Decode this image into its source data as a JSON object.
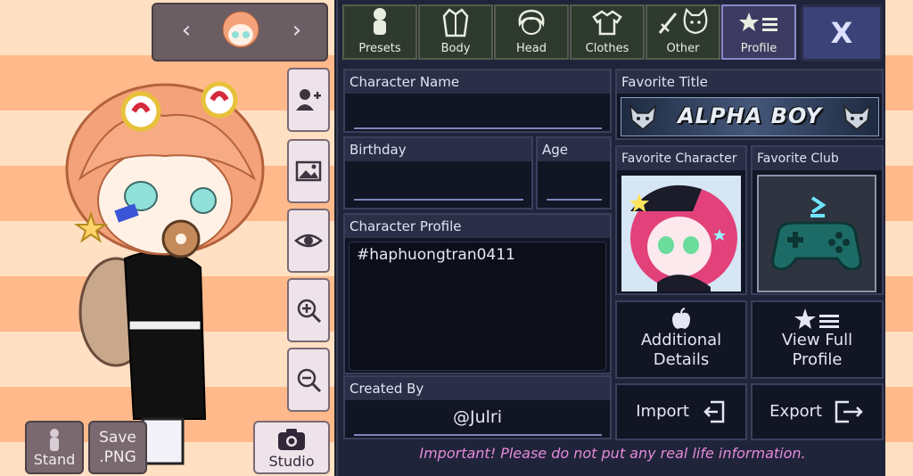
{
  "tabs": [
    {
      "label": "Presets",
      "icon": "preset-figure-icon",
      "active": false
    },
    {
      "label": "Body",
      "icon": "jacket-icon",
      "active": false
    },
    {
      "label": "Head",
      "icon": "hair-icon",
      "active": false
    },
    {
      "label": "Clothes",
      "icon": "tshirt-icon",
      "active": false
    },
    {
      "label": "Other",
      "icon": "sword-cat-icon",
      "active": false
    },
    {
      "label": "Profile",
      "icon": "star-list-icon",
      "active": true
    }
  ],
  "close_label": "X",
  "profile": {
    "character_name_label": "Character Name",
    "character_name_value": "",
    "favorite_title_label": "Favorite Title",
    "favorite_title_value": "ALPHA BOY",
    "birthday_label": "Birthday",
    "age_label": "Age",
    "favorite_character_label": "Favorite Character",
    "favorite_club_label": "Favorite Club",
    "character_profile_label": "Character Profile",
    "character_profile_value": "#haphuongtran0411",
    "created_by_label": "Created By",
    "created_by_value": "@Julri",
    "additional_details_label": "Additional Details",
    "view_full_profile_label": "View Full Profile",
    "import_label": "Import",
    "export_label": "Export",
    "warning": "Important! Please do not put any real life information."
  },
  "left": {
    "save_label_line1": "Save",
    "save_label_line2": ".PNG",
    "stand_label": "Stand",
    "studio_label": "Studio"
  },
  "colors": {
    "panel_bg": "#20243a",
    "active_tab": "#3d3b62",
    "warning_text": "#e48ad8",
    "stripe_light": "#ffe0c2",
    "stripe_dark": "#ffb98a"
  }
}
